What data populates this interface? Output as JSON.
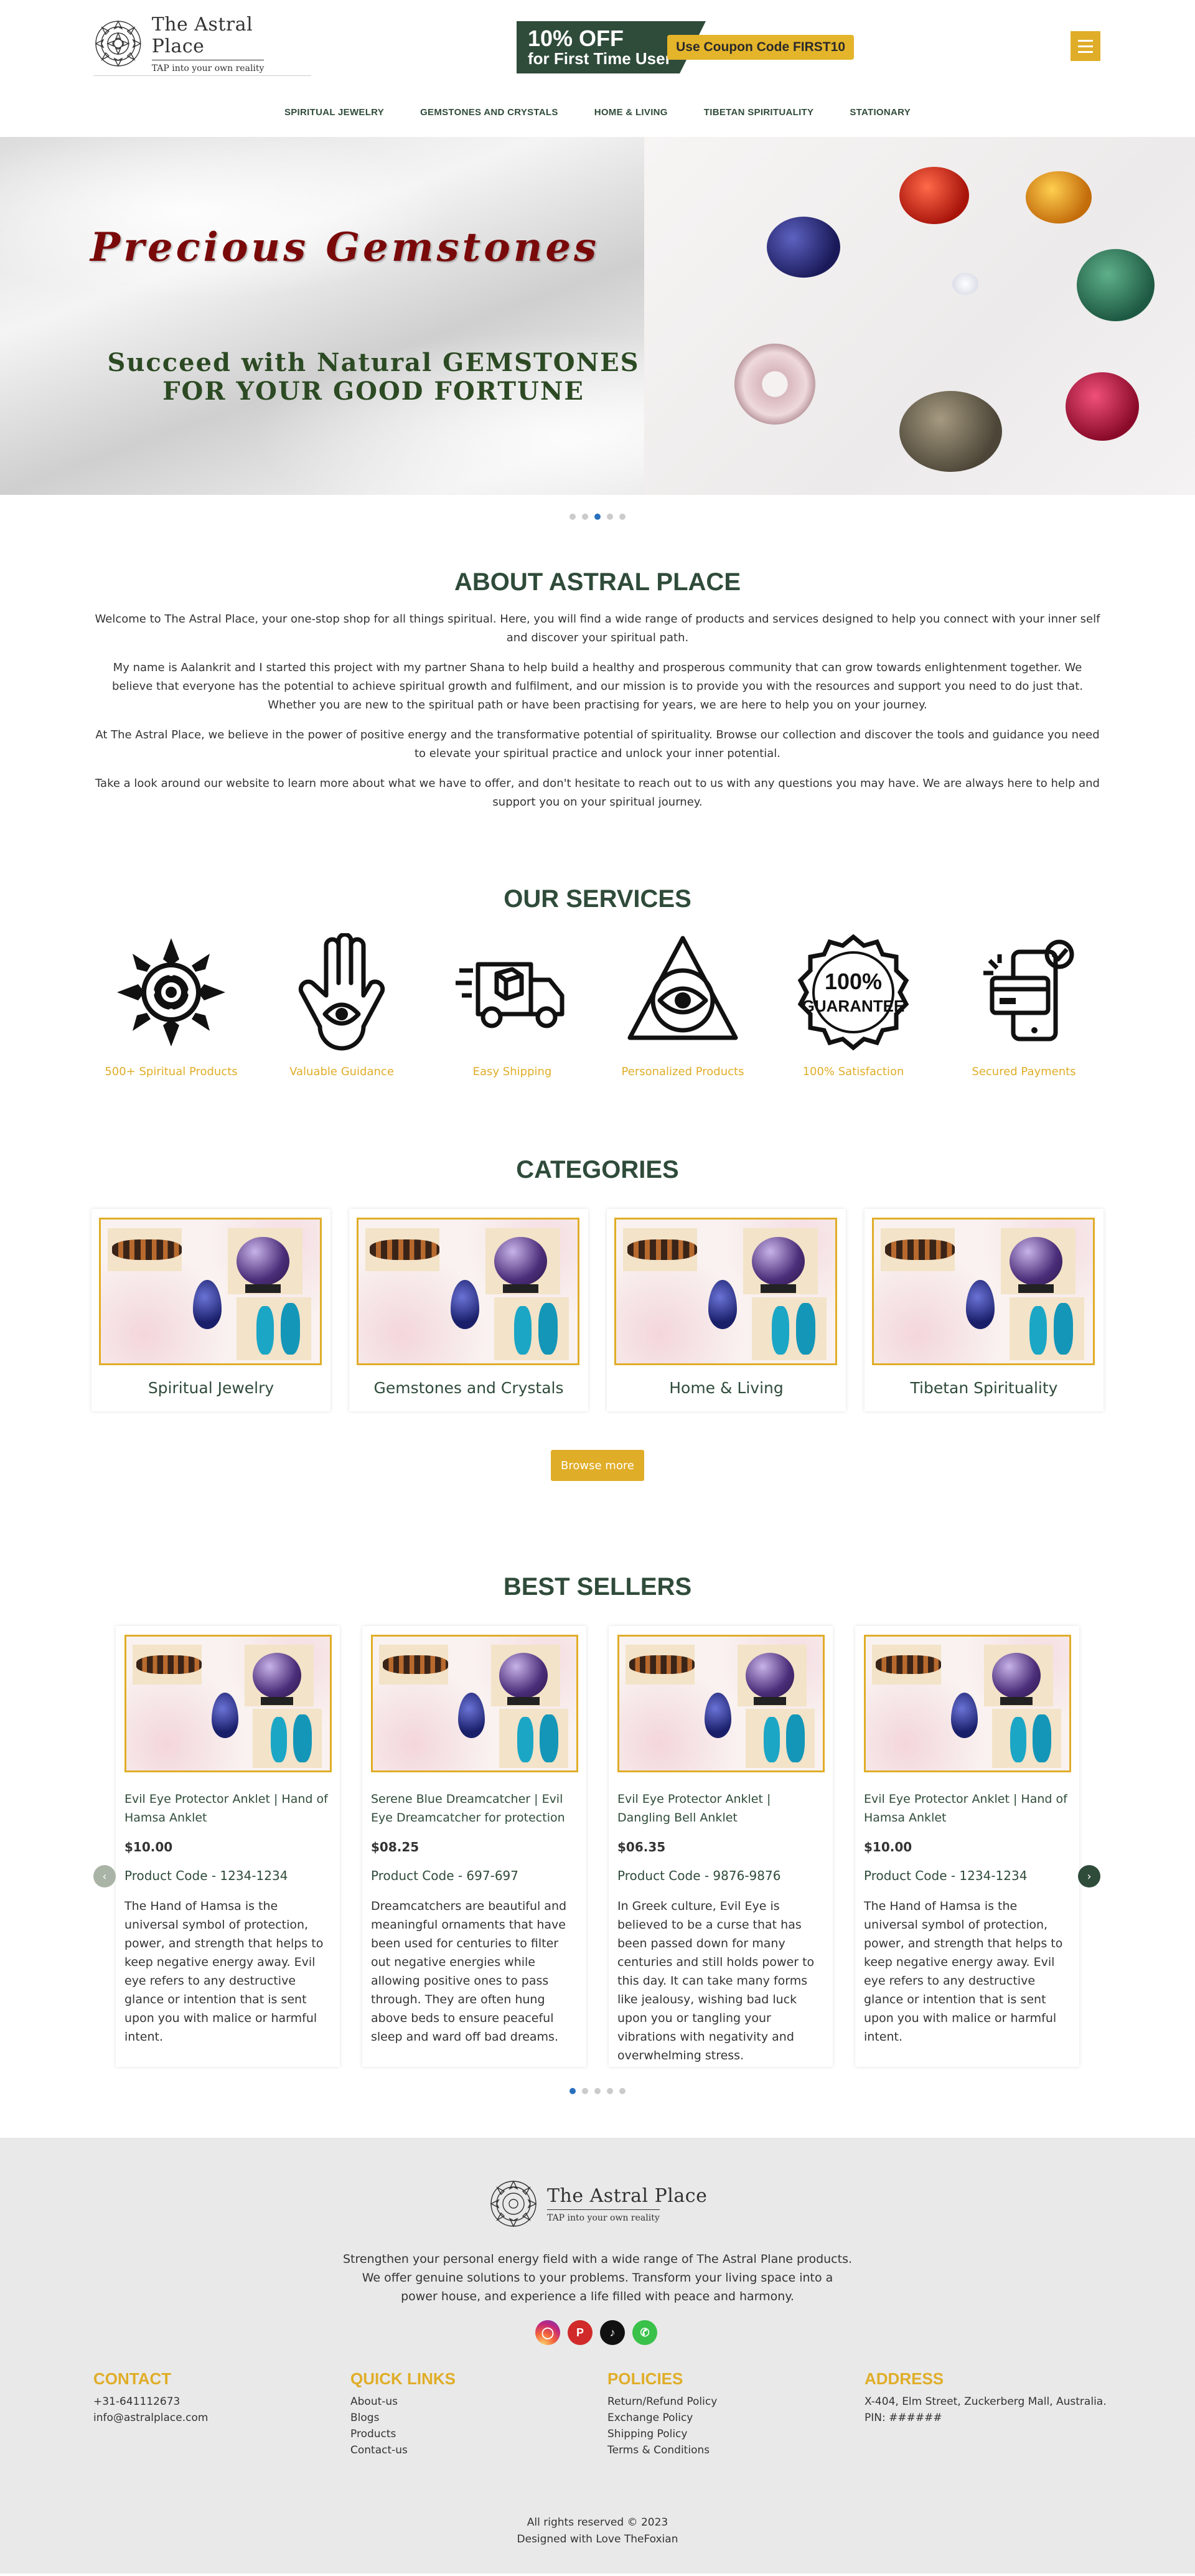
{
  "header": {
    "logo_title": "The Astral Place",
    "logo_tagline": "TAP into your own reality",
    "promo_big": "10% OFF",
    "promo_small": "for First Time User",
    "promo_coupon": "Use Coupon Code FIRST10"
  },
  "nav": [
    "SPIRITUAL JEWELRY",
    "GEMSTONES AND CRYSTALS",
    "HOME & LIVING",
    "TIBETAN SPIRITUALITY",
    "STATIONARY"
  ],
  "hero": {
    "title": "Precious Gemstones",
    "subtitle_line1": "Succeed with Natural GEMSTONES",
    "subtitle_line2": "FOR YOUR GOOD FORTUNE",
    "slides": 5,
    "active_slide": 3
  },
  "about": {
    "title": "ABOUT ASTRAL PLACE",
    "paragraphs": [
      "Welcome to The Astral Place, your one-stop shop for all things spiritual. Here, you will find a wide range of products and services designed to help you connect with your inner self and discover your spiritual path.",
      "My name is Aalankrit and I started this project with my partner Shana to help build a healthy and prosperous community that can grow towards enlightenment together. We believe that everyone has the potential to achieve spiritual growth and fulfilment, and our mission is to provide you with the resources and support you need to do just that. Whether you are new to the spiritual path or have been practising for years, we are here to help you on your journey.",
      "At The Astral Place, we believe in the power of positive energy and the transformative potential of spirituality. Browse our collection and discover the tools and guidance you need to elevate your spiritual practice and unlock your inner potential.",
      "Take a look around our website to learn more about what we have to offer, and don't hesitate to reach out to us with any questions you may have. We are always here to help and support you on your spiritual journey."
    ]
  },
  "services": {
    "title": "OUR SERVICES",
    "items": [
      {
        "label": "500+ Spiritual Products",
        "icon": "mandala-icon"
      },
      {
        "label": "Valuable Guidance",
        "icon": "hamsa-icon"
      },
      {
        "label": "Easy Shipping",
        "icon": "truck-icon"
      },
      {
        "label": "Personalized Products",
        "icon": "eye-triangle-icon"
      },
      {
        "label": "100% Satisfaction",
        "icon": "guarantee-badge-icon"
      },
      {
        "label": "Secured Payments",
        "icon": "secure-payment-icon"
      }
    ]
  },
  "categories": {
    "title": "CATEGORIES",
    "items": [
      "Spiritual Jewelry",
      "Gemstones and Crystals",
      "Home & Living",
      "Tibetan Spirituality"
    ],
    "browse_label": "Browse more"
  },
  "best_sellers": {
    "title": "BEST SELLERS",
    "products": [
      {
        "name": "Evil Eye Protector Anklet | Hand of Hamsa Anklet",
        "price": "$10.00",
        "code": "Product Code - 1234-1234",
        "desc": "The Hand of Hamsa is the universal symbol of protection, power, and strength that helps to keep negative energy away. Evil eye refers to any destructive glance or intention that is sent upon you with malice or harmful intent."
      },
      {
        "name": "Serene Blue Dreamcatcher | Evil Eye Dreamcatcher for protection",
        "price": "$08.25",
        "code": "Product Code - 697-697",
        "desc": "Dreamcatchers are beautiful and meaningful ornaments that have been used for centuries to filter out negative energies while allowing positive ones to pass through. They are often hung above beds to ensure peaceful sleep and ward off bad dreams."
      },
      {
        "name": "Evil Eye Protector Anklet | Dangling Bell Anklet",
        "price": "$06.35",
        "code": "Product Code - 9876-9876",
        "desc": "In Greek culture, Evil Eye is believed to be a curse that has been passed down for many centuries and still holds power to this day. It can take many forms like jealousy, wishing bad luck upon you or tangling your vibrations with negativity and overwhelming stress."
      },
      {
        "name": "Evil Eye Protector Anklet | Hand of Hamsa Anklet",
        "price": "$10.00",
        "code": "Product Code - 1234-1234",
        "desc": "The Hand of Hamsa is the universal symbol of protection, power, and strength that helps to keep negative energy away. Evil eye refers to any destructive glance or intention that is sent upon you with malice or harmful intent."
      }
    ],
    "slides": 5,
    "active_slide": 1
  },
  "footer": {
    "description": "Strengthen your personal energy field with a wide range of The Astral Plane products. We offer genuine solutions to your problems. Transform your living space into a power house, and experience a life filled with peace and harmony.",
    "socials": [
      "instagram-icon",
      "pinterest-icon",
      "tiktok-icon",
      "whatsapp-icon"
    ],
    "contact": {
      "title": "CONTACT",
      "phone": "+31-641112673",
      "email": "info@astralplace.com"
    },
    "quick_links": {
      "title": "QUICK LINKS",
      "items": [
        "About-us",
        "Blogs",
        "Products",
        "Contact-us"
      ]
    },
    "policies": {
      "title": "POLICIES",
      "items": [
        "Return/Refund Policy",
        "Exchange Policy",
        "Shipping Policy",
        "Terms & Conditions"
      ]
    },
    "address": {
      "title": "ADDRESS",
      "line1": "X-404, Elm Street, Zuckerberg Mall, Australia.",
      "line2": "PIN: ######"
    },
    "copyright": "All rights reserved © 2023",
    "credit": "Designed with Love TheFoxian"
  },
  "colors": {
    "primary_green": "#2f4b3a",
    "accent_gold": "#e0ad28",
    "footer_bg": "#e9e9e9"
  }
}
